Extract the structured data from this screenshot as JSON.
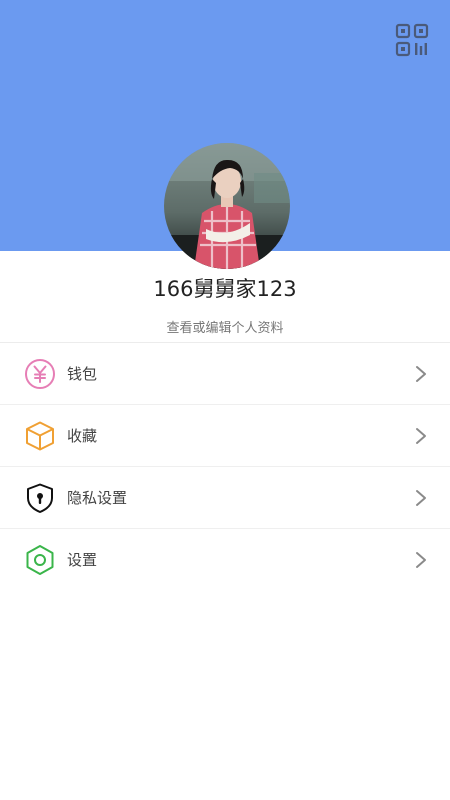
{
  "profile": {
    "username": "166舅舅家123",
    "edit_link": "查看或编辑个人资料"
  },
  "colors": {
    "header_background": "#6b9af0",
    "wallet_icon": "#e67eb5",
    "favorites_icon": "#f0a033",
    "privacy_icon": "#111111",
    "settings_icon": "#3ab54a"
  },
  "header": {
    "qr_icon": "qr-code-icon"
  },
  "menu": {
    "items": [
      {
        "label": "钱包",
        "icon": "yuan-circle-icon"
      },
      {
        "label": "收藏",
        "icon": "box-icon"
      },
      {
        "label": "隐私设置",
        "icon": "shield-lock-icon"
      },
      {
        "label": "设置",
        "icon": "hexagon-gear-icon"
      }
    ]
  }
}
